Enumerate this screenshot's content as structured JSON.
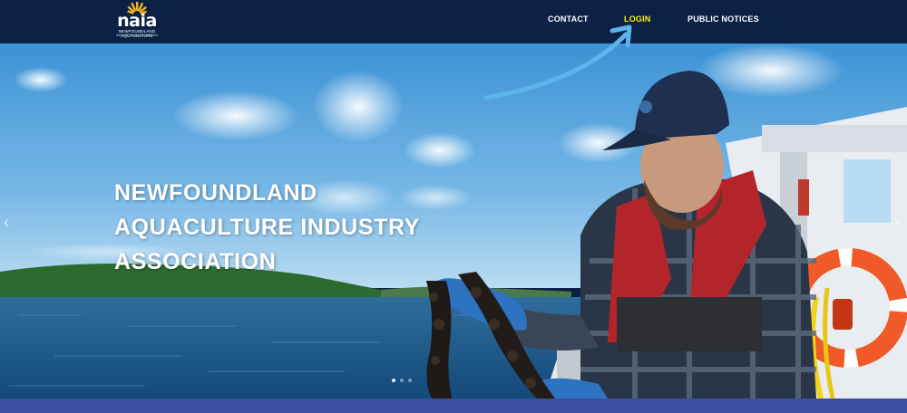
{
  "logo": {
    "word": "naia",
    "subtitle": "NEWFOUNDLAND AQUACULTURE",
    "subtitle2": "INDUSTRY ASSOCIATION"
  },
  "nav": {
    "items": [
      {
        "label": "CONTACT"
      },
      {
        "label": "LOGIN"
      },
      {
        "label": "PUBLIC NOTICES"
      }
    ]
  },
  "hero": {
    "title_lines": [
      "NEWFOUNDLAND",
      "AQUACULTURE INDUSTRY",
      "ASSOCIATION"
    ],
    "prev_arrow": "‹",
    "next_arrow": "›",
    "slide_count": 3,
    "active_slide": 1
  },
  "colors": {
    "nav_bg": "#0b2146",
    "login_text": "#fff200",
    "strip": "#3b4fa0",
    "annotation_arrow": "#5bb4ea"
  }
}
